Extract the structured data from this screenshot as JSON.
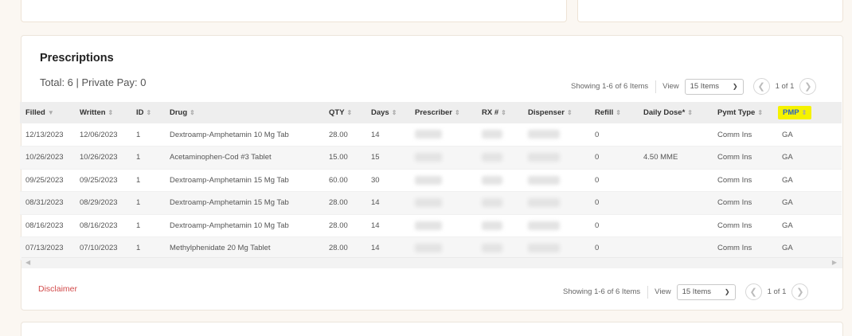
{
  "prescriptions": {
    "title": "Prescriptions",
    "totals": "Total: 6 | Private Pay: 0",
    "pager": {
      "showing": "Showing 1-6 of 6 Items",
      "view_label": "View",
      "view_value": "15 Items",
      "page": "1 of 1"
    },
    "columns": [
      "Filled",
      "Written",
      "ID",
      "Drug",
      "QTY",
      "Days",
      "Prescriber",
      "RX #",
      "Dispenser",
      "Refill",
      "Daily Dose*",
      "Pymt Type",
      "PMP"
    ],
    "rows": [
      {
        "filled": "12/13/2023",
        "written": "12/06/2023",
        "id": "1",
        "drug": "Dextroamp-Amphetamin 10 Mg Tab",
        "qty": "28.00",
        "days": "14",
        "refill": "0",
        "daily_dose": "",
        "pymt_type": "Comm Ins",
        "pmp": "GA"
      },
      {
        "filled": "10/26/2023",
        "written": "10/26/2023",
        "id": "1",
        "drug": "Acetaminophen-Cod #3 Tablet",
        "qty": "15.00",
        "days": "15",
        "refill": "0",
        "daily_dose": "4.50 MME",
        "pymt_type": "Comm Ins",
        "pmp": "GA"
      },
      {
        "filled": "09/25/2023",
        "written": "09/25/2023",
        "id": "1",
        "drug": "Dextroamp-Amphetamin 15 Mg Tab",
        "qty": "60.00",
        "days": "30",
        "refill": "0",
        "daily_dose": "",
        "pymt_type": "Comm Ins",
        "pmp": "GA"
      },
      {
        "filled": "08/31/2023",
        "written": "08/29/2023",
        "id": "1",
        "drug": "Dextroamp-Amphetamin 15 Mg Tab",
        "qty": "28.00",
        "days": "14",
        "refill": "0",
        "daily_dose": "",
        "pymt_type": "Comm Ins",
        "pmp": "GA"
      },
      {
        "filled": "08/16/2023",
        "written": "08/16/2023",
        "id": "1",
        "drug": "Dextroamp-Amphetamin 10 Mg Tab",
        "qty": "28.00",
        "days": "14",
        "refill": "0",
        "daily_dose": "",
        "pymt_type": "Comm Ins",
        "pmp": "GA"
      },
      {
        "filled": "07/13/2023",
        "written": "07/10/2023",
        "id": "1",
        "drug": "Methylphenidate 20 Mg Tablet",
        "qty": "28.00",
        "days": "14",
        "refill": "0",
        "daily_dose": "",
        "pymt_type": "Comm Ins",
        "pmp": "GA"
      }
    ],
    "disclaimer": "Disclaimer",
    "icons": {
      "sort": "sort-icon",
      "sort_desc": "sort-desc-icon",
      "prev": "chevron-left-icon",
      "next": "chevron-right-icon",
      "dropdown": "chevron-down-icon"
    },
    "colors": {
      "highlight": "#f5f200",
      "disclaimer": "#d24a4a",
      "pmp_text": "#2a62c4"
    }
  }
}
